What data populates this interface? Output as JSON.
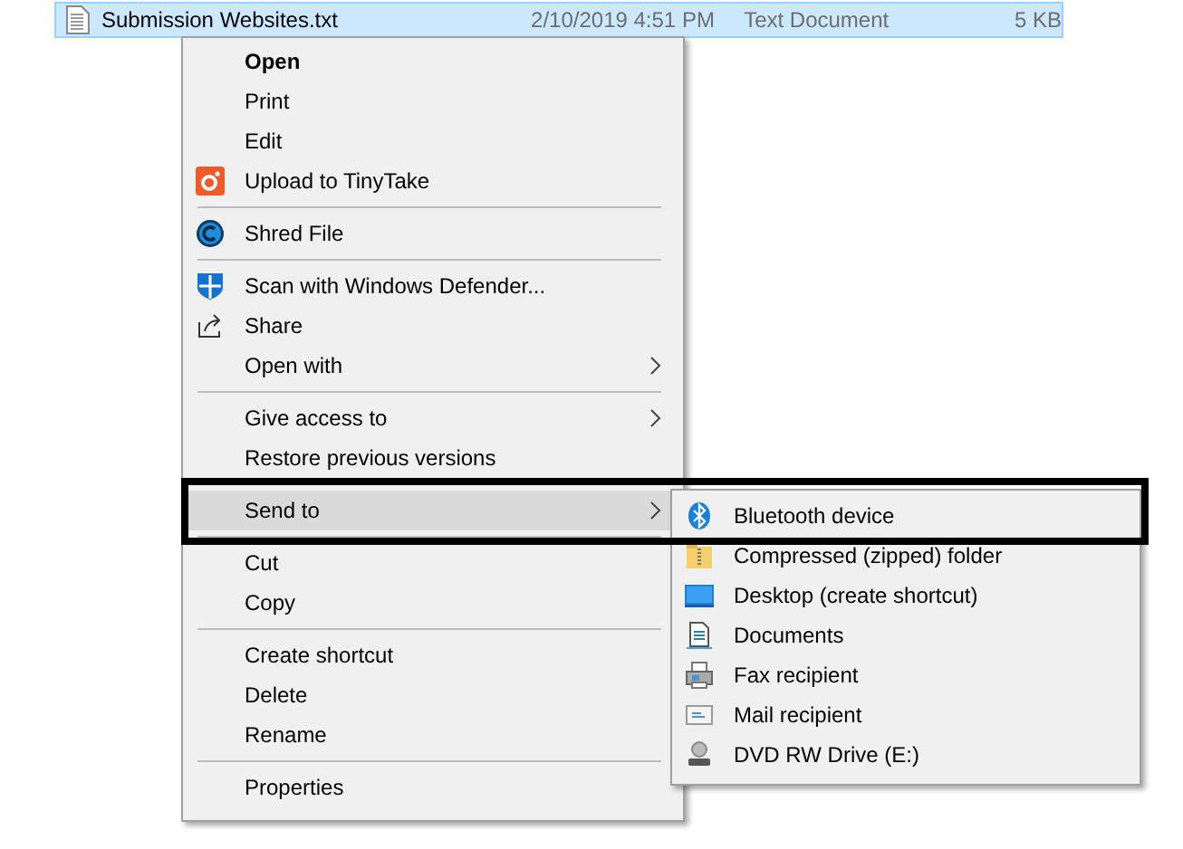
{
  "file_row": {
    "name": "Submission Websites.txt",
    "date": "2/10/2019 4:51 PM",
    "type": "Text Document",
    "size": "5 KB",
    "selected": true
  },
  "context_menu": {
    "groups": [
      [
        {
          "label": "Open",
          "default": true,
          "has_submenu": false,
          "selected": false
        },
        {
          "label": "Print",
          "default": false,
          "has_submenu": false,
          "selected": false
        },
        {
          "label": "Edit",
          "default": false,
          "has_submenu": false,
          "selected": false
        },
        {
          "label": "Upload to TinyTake",
          "default": false,
          "has_submenu": false,
          "selected": false
        }
      ],
      [
        {
          "label": "Shred File",
          "default": false,
          "has_submenu": false,
          "selected": false
        }
      ],
      [
        {
          "label": "Scan with Windows Defender...",
          "default": false,
          "has_submenu": false,
          "selected": false
        },
        {
          "label": "Share",
          "default": false,
          "has_submenu": false,
          "selected": false
        },
        {
          "label": "Open with",
          "default": false,
          "has_submenu": true,
          "selected": false
        }
      ],
      [
        {
          "label": "Give access to",
          "default": false,
          "has_submenu": true,
          "selected": false
        },
        {
          "label": "Restore previous versions",
          "default": false,
          "has_submenu": false,
          "selected": false
        }
      ],
      [
        {
          "label": "Send to",
          "default": false,
          "has_submenu": true,
          "selected": true
        }
      ],
      [
        {
          "label": "Cut",
          "default": false,
          "has_submenu": false,
          "selected": false
        },
        {
          "label": "Copy",
          "default": false,
          "has_submenu": false,
          "selected": false
        }
      ],
      [
        {
          "label": "Create shortcut",
          "default": false,
          "has_submenu": false,
          "selected": false
        },
        {
          "label": "Delete",
          "default": false,
          "has_submenu": false,
          "selected": false
        },
        {
          "label": "Rename",
          "default": false,
          "has_submenu": false,
          "selected": false
        }
      ],
      [
        {
          "label": "Properties",
          "default": false,
          "has_submenu": false,
          "selected": false
        }
      ]
    ]
  },
  "send_to_menu": {
    "items": [
      {
        "label": "Bluetooth device",
        "selected": false
      },
      {
        "label": "Compressed (zipped) folder",
        "selected": false
      },
      {
        "label": "Desktop (create shortcut)",
        "selected": false
      },
      {
        "label": "Documents",
        "selected": false
      },
      {
        "label": "Fax recipient",
        "selected": false
      },
      {
        "label": "Mail recipient",
        "selected": false
      },
      {
        "label": "DVD RW Drive (E:)",
        "selected": false
      }
    ]
  }
}
